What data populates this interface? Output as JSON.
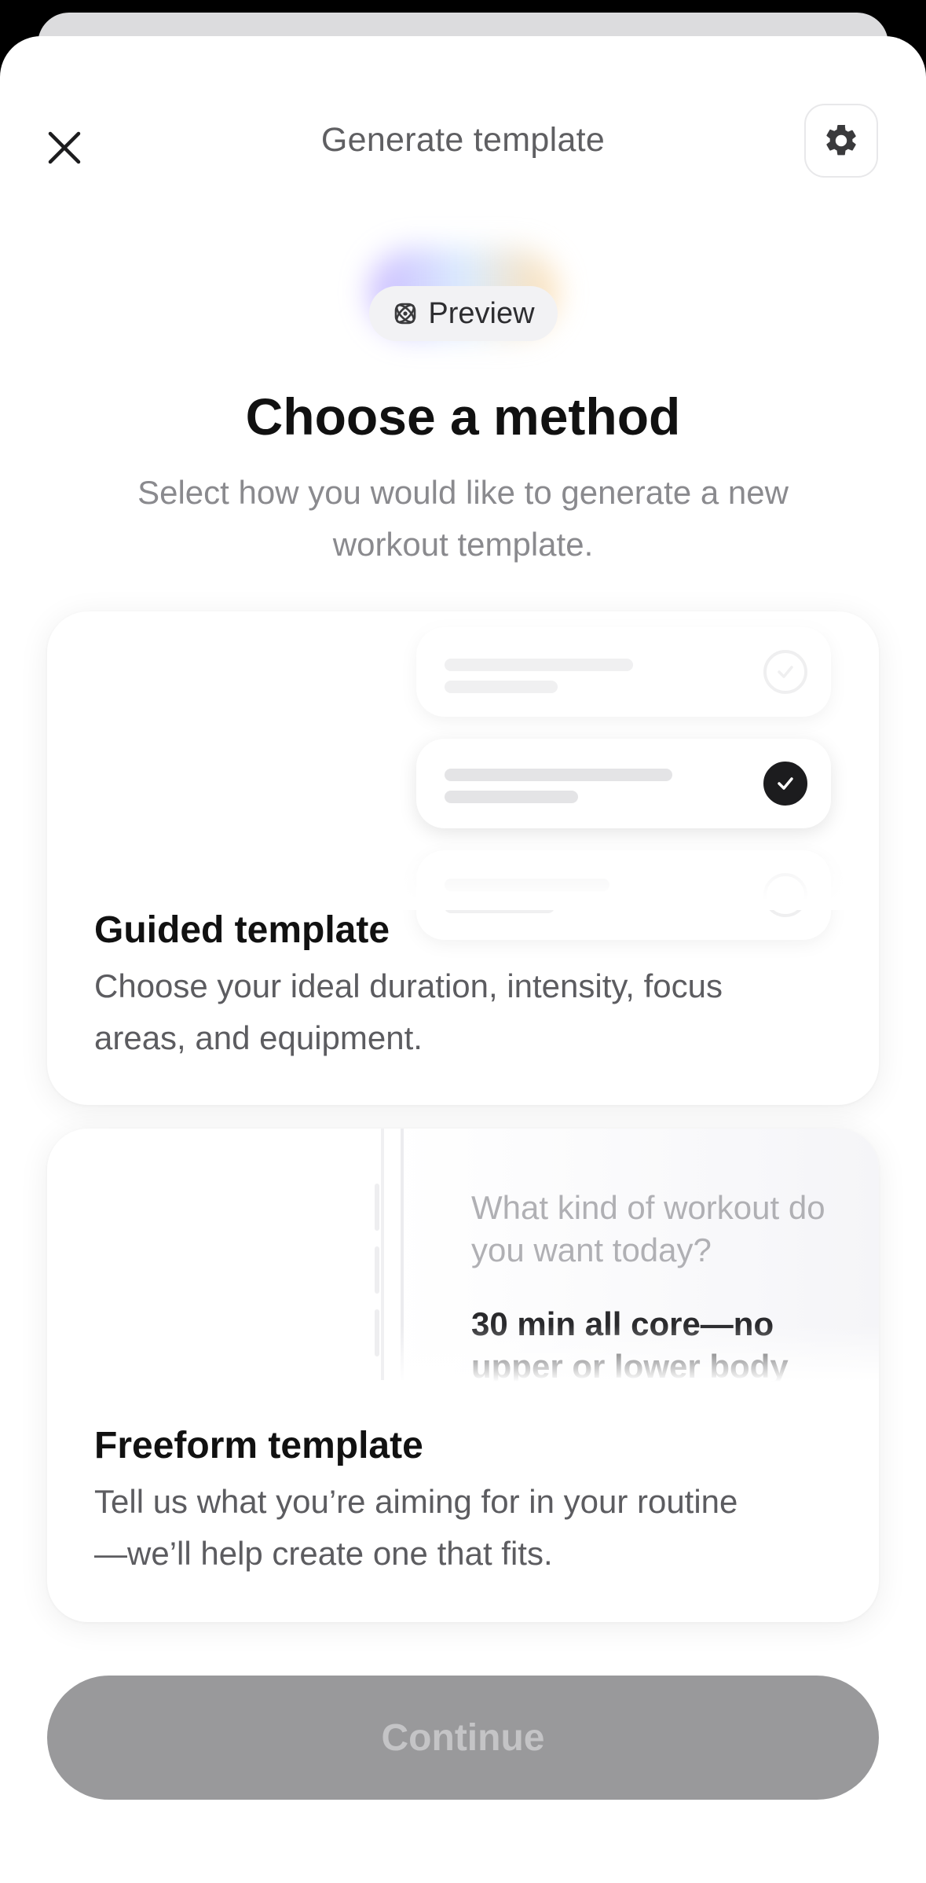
{
  "header": {
    "title": "Generate template",
    "close_icon": "close-icon",
    "settings_icon": "gear-icon"
  },
  "badge": {
    "label": "Preview",
    "icon": "atom-icon"
  },
  "intro": {
    "title": "Choose a method",
    "subtitle": "Select how you would like to generate a new workout template."
  },
  "cards": [
    {
      "title": "Guided template",
      "description": "Choose your ideal duration, intensity, focus areas, and equipment.",
      "illustration": {
        "selected_option_index": 1,
        "option_count": 3
      }
    },
    {
      "title": "Freeform template",
      "description": "Tell us what you’re aiming for in your routine—we’ll help create one that fits.",
      "illustration": {
        "question": "What kind of workout do you want today?",
        "answer": "30 min all core—no upper or lower body"
      }
    }
  ],
  "footer": {
    "continue_label": "Continue",
    "continue_enabled": false
  },
  "colors": {
    "button_disabled": "#99999b",
    "button_disabled_text": "#c4c4c6",
    "check_selected": "#1c1c1e"
  }
}
